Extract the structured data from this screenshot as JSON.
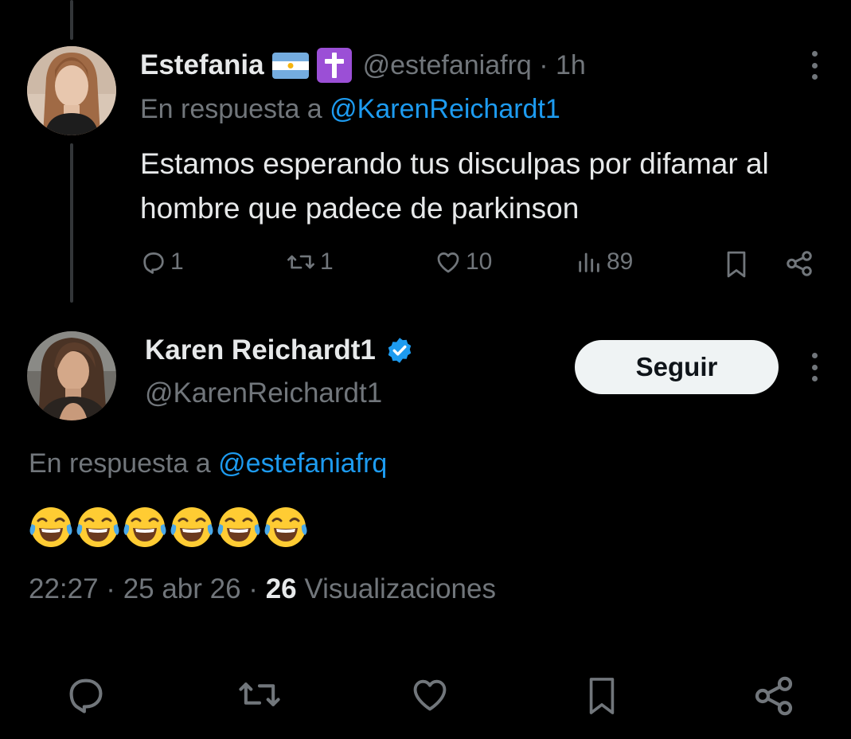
{
  "tweet1": {
    "display_name": "Estefania",
    "flag_icon": "argentina-flag-icon",
    "badge_icon": "latin-cross-icon",
    "handle_time": "@estefaniafrq · 1h",
    "reply_prefix": "En respuesta a",
    "reply_mention": "@KarenReichardt1",
    "text": "Estamos esperando tus disculpas por difamar al hombre que padece de parkinson",
    "replies": "1",
    "retweets": "1",
    "likes": "10",
    "views": "89"
  },
  "tweet2": {
    "display_name": "Karen Reichardt1",
    "verified_icon": "verified-badge-icon",
    "handle": "@KarenReichardt1",
    "follow_label": "Seguir",
    "reply_prefix": "En respuesta a",
    "reply_mention": "@estefaniafrq",
    "emoji_text": "😂😂😂😂😂😂",
    "time": "22:27 · 25 abr 26 · ",
    "views_count": "26",
    "views_label": " Visualizaciones"
  },
  "colors": {
    "background": "#000000",
    "text": "#e7e9ea",
    "muted": "#71767b",
    "link": "#1d9bf0",
    "follow_bg": "#eff3f4"
  }
}
